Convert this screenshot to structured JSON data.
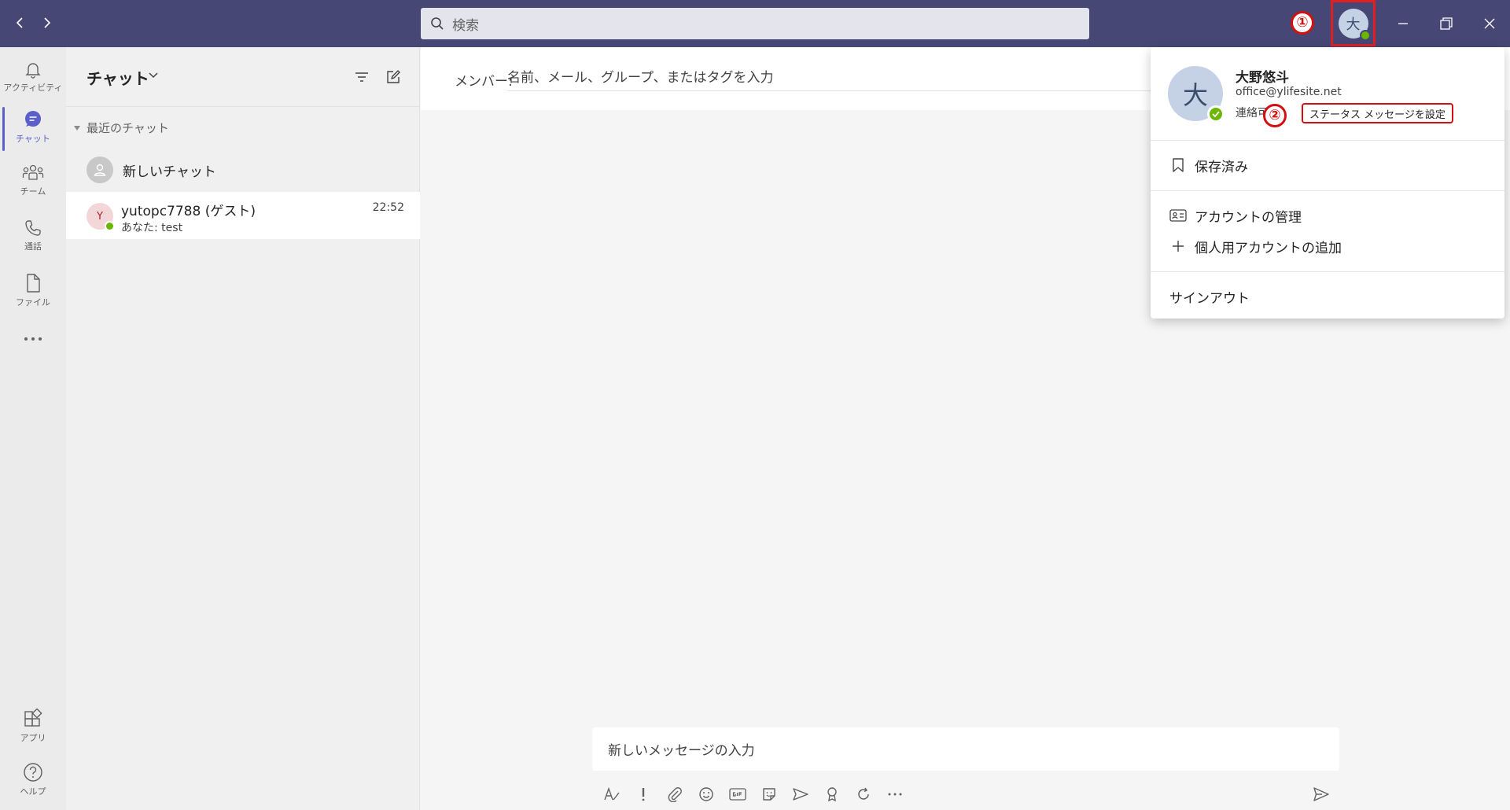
{
  "colors": {
    "titlebar": "#464775",
    "accent": "#5b5fc7",
    "presence_available": "#6bb700",
    "annotation_red": "#d21010"
  },
  "search": {
    "placeholder": "検索"
  },
  "annotations": {
    "step1": "①",
    "step2": "②"
  },
  "user": {
    "initial": "大",
    "name": "大野悠斗",
    "email": "office@ylifesite.net",
    "status": "連絡可能"
  },
  "rail": {
    "items": [
      {
        "label": "アクティビティ",
        "icon": "bell-icon"
      },
      {
        "label": "チャット",
        "icon": "chat-icon"
      },
      {
        "label": "チーム",
        "icon": "teams-icon"
      },
      {
        "label": "通話",
        "icon": "phone-icon"
      },
      {
        "label": "ファイル",
        "icon": "file-icon"
      },
      {
        "label": "アプリ",
        "icon": "apps-icon"
      },
      {
        "label": "ヘルプ",
        "icon": "help-icon"
      }
    ]
  },
  "chat_list": {
    "title": "チャット",
    "section": "最近のチャット",
    "new_chat": "新しいチャット",
    "items": [
      {
        "initial": "Y",
        "name": "yutopc7788 (ゲスト)",
        "preview": "あなた: test",
        "time": "22:52"
      }
    ]
  },
  "main": {
    "to_label": "メンバー:",
    "to_placeholder": "名前、メール、グループ、またはタグを入力",
    "compose_placeholder": "新しいメッセージの入力"
  },
  "account_menu": {
    "set_status_message": "ステータス メッセージを設定",
    "saved": "保存済み",
    "manage_account": "アカウントの管理",
    "add_personal_account": "個人用アカウントの追加",
    "sign_out": "サインアウト"
  }
}
